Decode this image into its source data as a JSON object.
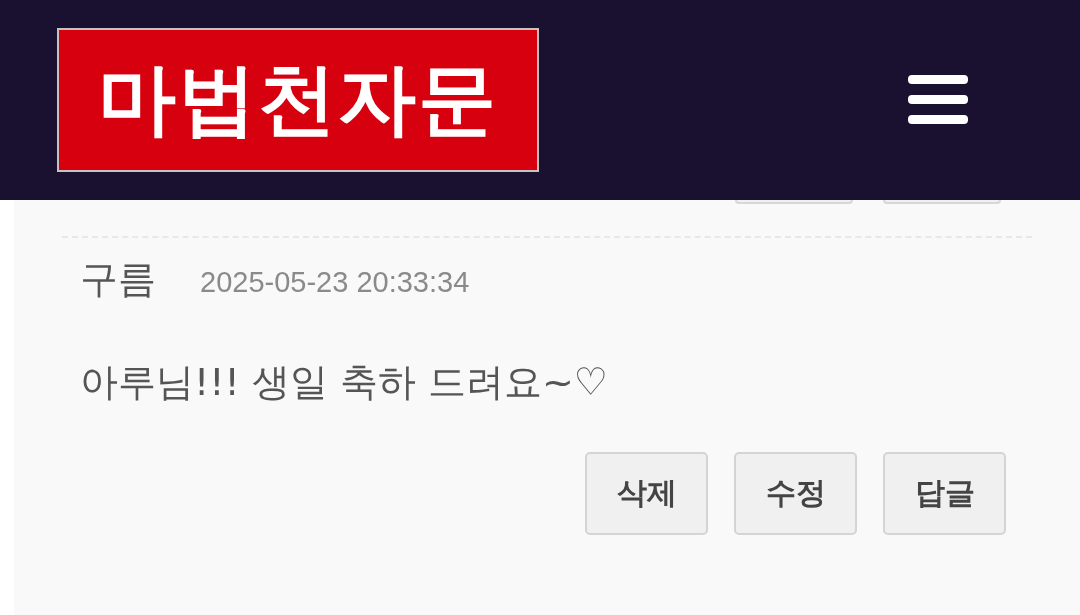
{
  "header": {
    "logo": "마법천자문"
  },
  "comment": {
    "author": "구름",
    "date": "2025-05-23 20:33:34",
    "text": "아루님!!! 생일 축하 드려요~♡",
    "buttons": [
      {
        "label": "삭제"
      },
      {
        "label": "수정"
      },
      {
        "label": "답글"
      }
    ]
  }
}
